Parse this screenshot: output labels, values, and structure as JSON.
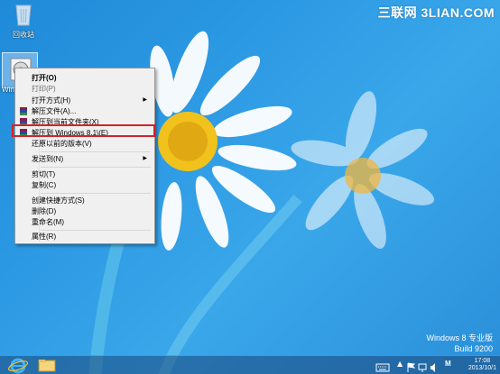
{
  "watermark": "三联网 3LIAN.COM",
  "desktop_icons": {
    "recycle_bin_label": "回收站",
    "file_label": "Windows 8.1"
  },
  "context_menu": {
    "items": [
      {
        "label": "打开(O)",
        "bold": true,
        "icon": "none",
        "submenu": false
      },
      {
        "label": "打印(P)",
        "icon": "none",
        "submenu": false
      },
      {
        "label": "打开方式(H)",
        "icon": "none",
        "submenu": true
      },
      {
        "label": "解压文件(A)...",
        "icon": "winrar-icon",
        "submenu": false
      },
      {
        "label": "解压到当前文件夹(X)",
        "icon": "winrar-icon",
        "submenu": false
      },
      {
        "label": "解压到 Windows 8.1\\(E)",
        "icon": "winrar-icon",
        "submenu": false,
        "highlighted": true
      },
      {
        "label": "还原以前的版本(V)",
        "icon": "none",
        "submenu": false
      },
      {
        "label": "发送到(N)",
        "icon": "none",
        "submenu": true
      },
      {
        "label": "剪切(T)",
        "icon": "none",
        "submenu": false
      },
      {
        "label": "复制(C)",
        "icon": "none",
        "submenu": false
      },
      {
        "label": "创建快捷方式(S)",
        "icon": "none",
        "submenu": false
      },
      {
        "label": "删除(D)",
        "icon": "none",
        "submenu": false
      },
      {
        "label": "重命名(M)",
        "icon": "none",
        "submenu": false
      },
      {
        "label": "属性(R)",
        "icon": "none",
        "submenu": false
      }
    ]
  },
  "os_version": {
    "line1": "Windows 8 专业版",
    "line2": "Build 9200"
  },
  "taskbar": {
    "clock_time": "17:08",
    "clock_date": "2013/10/1",
    "ime_label": "M",
    "colors": {
      "accent_red": "#d2232a",
      "desktop_blue": "#2d9ae4"
    }
  }
}
